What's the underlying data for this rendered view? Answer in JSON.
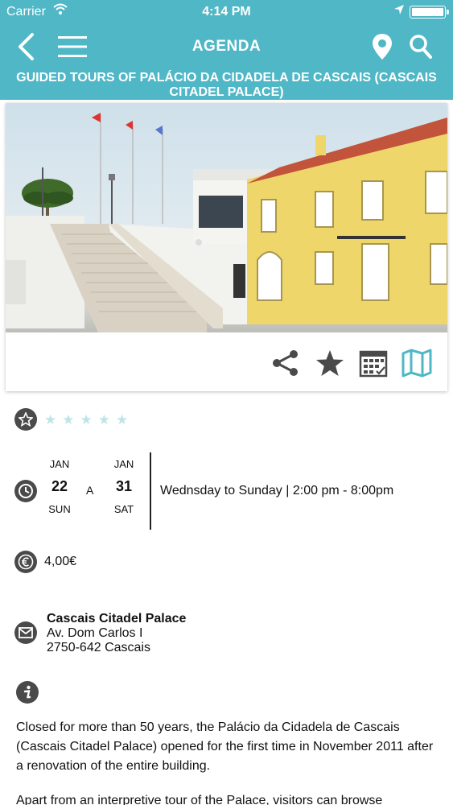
{
  "status": {
    "carrier": "Carrier",
    "time": "4:14 PM"
  },
  "nav": {
    "title": "AGENDA"
  },
  "event": {
    "title": "GUIDED TOURS OF PALÁCIO DA CIDADELA DE CASCAIS (CASCAIS CITADEL PALACE)",
    "rating_stars": 5,
    "start": {
      "month": "JAN",
      "day": "22",
      "weekday": "SUN"
    },
    "range_sep": "A",
    "end": {
      "month": "JAN",
      "day": "31",
      "weekday": "SAT"
    },
    "schedule": "Wednsday to Sunday | 2:00 pm - 8:00pm",
    "price": "4,00€",
    "venue": "Cascais Citadel Palace",
    "address_line1": "Av. Dom Carlos I",
    "address_line2": "2750-642 Cascais",
    "description_1": "Closed for more than 50 years, the Palácio da Cidadela de Cascais (Cascais Citadel Palace) opened for the first time in November 2011 after a renovation of the entire building.",
    "description_2": "Apart from an interpretive tour of the Palace, visitors can browse"
  },
  "icons": {
    "back": "chevron-left-icon",
    "menu": "hamburger-icon",
    "map_pin": "map-pin-icon",
    "search": "search-icon",
    "share": "share-icon",
    "favorite": "star-icon",
    "calendar": "calendar-icon",
    "map": "map-icon",
    "rating": "star-outline-icon",
    "clock": "clock-icon",
    "euro": "euro-icon",
    "mail": "mail-icon",
    "info": "info-icon"
  },
  "colors": {
    "accent": "#4fb7c6",
    "icon_dark": "#4a4a4a",
    "star_empty": "#bfe4e8"
  }
}
